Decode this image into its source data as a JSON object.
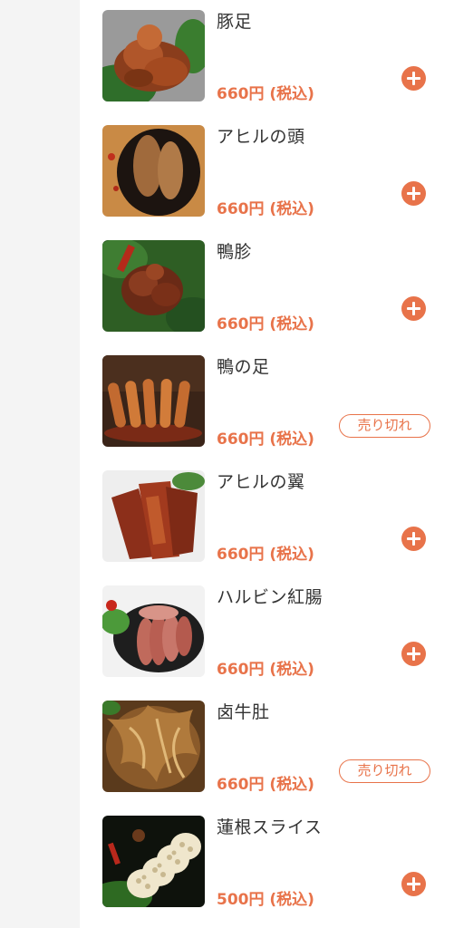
{
  "menu_items": [
    {
      "name": "豚足",
      "price": "660円 (税込)",
      "action": "add",
      "action_icon": "plus-circle-icon"
    },
    {
      "name": "アヒルの頭",
      "price": "660円 (税込)",
      "action": "add",
      "action_icon": "plus-circle-icon"
    },
    {
      "name": "鴨胗",
      "price": "660円 (税込)",
      "action": "add",
      "action_icon": "plus-circle-icon"
    },
    {
      "name": "鴨の足",
      "price": "660円 (税込)",
      "action": "soldout",
      "soldout_label": "売り切れ"
    },
    {
      "name": "アヒルの翼",
      "price": "660円 (税込)",
      "action": "add",
      "action_icon": "plus-circle-icon"
    },
    {
      "name": "ハルビン紅腸",
      "price": "660円 (税込)",
      "action": "add",
      "action_icon": "plus-circle-icon"
    },
    {
      "name": "卤牛肚",
      "price": "660円 (税込)",
      "action": "soldout",
      "soldout_label": "売り切れ"
    },
    {
      "name": "蓮根スライス",
      "price": "500円 (税込)",
      "action": "add",
      "action_icon": "plus-circle-icon"
    }
  ],
  "colors": {
    "accent": "#e8734a",
    "text": "#333333",
    "rail": "#f4f4f4"
  }
}
